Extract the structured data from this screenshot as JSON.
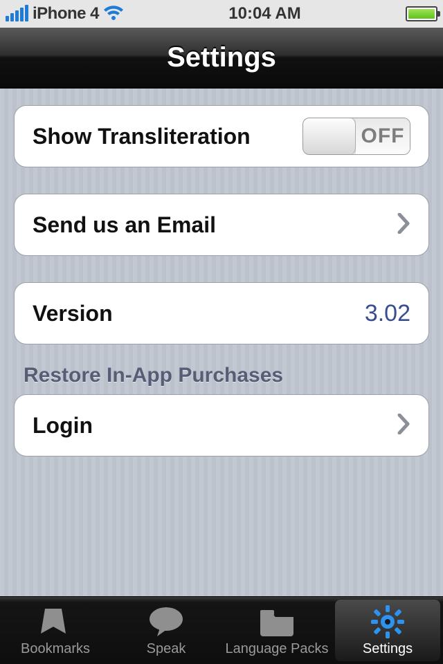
{
  "status": {
    "carrier": "iPhone 4",
    "time": "10:04 AM"
  },
  "header": {
    "title": "Settings"
  },
  "rows": {
    "translit": {
      "label": "Show Transliteration",
      "toggle_state": "OFF"
    },
    "email": {
      "label": "Send us an Email"
    },
    "version": {
      "label": "Version",
      "value": "3.02"
    },
    "login": {
      "label": "Login"
    }
  },
  "sections": {
    "restore_header": "Restore In-App Purchases"
  },
  "tabs": {
    "bookmarks": "Bookmarks",
    "speak": "Speak",
    "language_packs": "Language Packs",
    "settings": "Settings",
    "active": "settings"
  }
}
